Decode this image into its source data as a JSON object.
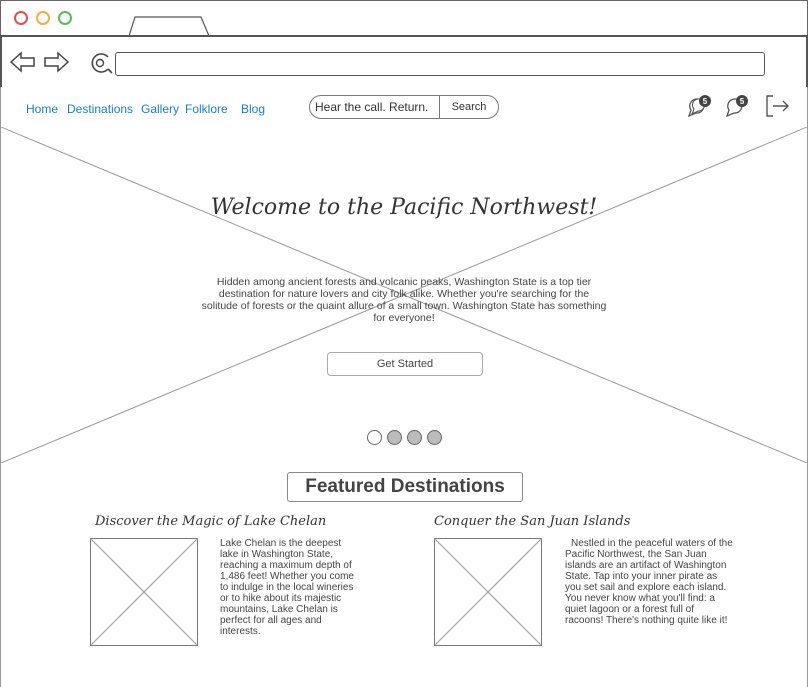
{
  "browser": {
    "window_controls": [
      "close",
      "minimize",
      "maximize"
    ],
    "colors": {
      "close": "#d9534f",
      "minimize": "#f0ad4e",
      "maximize": "#5cb85c"
    },
    "url": ""
  },
  "nav": {
    "items": [
      {
        "label": "Home"
      },
      {
        "label": "Destinations"
      },
      {
        "label": "Gallery"
      },
      {
        "label": "Folklore"
      },
      {
        "label": "Blog"
      }
    ],
    "color": "#1a7fc1"
  },
  "search": {
    "placeholder": "Hear the call. Return.",
    "button_label": "Search"
  },
  "header_icons": {
    "messages_icon": "chat-bubbles-icon",
    "messages_count": "5",
    "notifications_icon": "speech-bubble-icon",
    "notifications_count": "5",
    "logout_icon": "logout-icon"
  },
  "hero": {
    "title": "Welcome to the Pacific Northwest!",
    "text": "Hidden among ancient forests and volcanic peaks, Washington State is a top tier destination for nature lovers and city folk alike. Whether you're searching for the solitude of forests or the quaint allure of a small town. Washington State has something for everyone!",
    "button_label": "Get Started",
    "carousel": {
      "count": 4,
      "active": 0
    }
  },
  "featured": {
    "title": "Featured Destinations",
    "cards": [
      {
        "title": "Discover the Magic of Lake Chelan",
        "text": "Lake Chelan is the deepest lake in Washington State, reaching a maximum depth of 1,486 feet! Whether you come to indulge in the local wineries or to hike about its majestic mountains, Lake Chelan is perfect for all ages and interests."
      },
      {
        "title": "Conquer the San Juan Islands",
        "text": "Nestled in the peaceful waters of the Pacific Northwest, the San Juan islands are an artifact of Washington State. Tap into your inner pirate as you set sail and explore each island. You never know what you'll find: a quiet lagoon or a forest full of racoons! There's nothing quite like it!"
      }
    ]
  }
}
